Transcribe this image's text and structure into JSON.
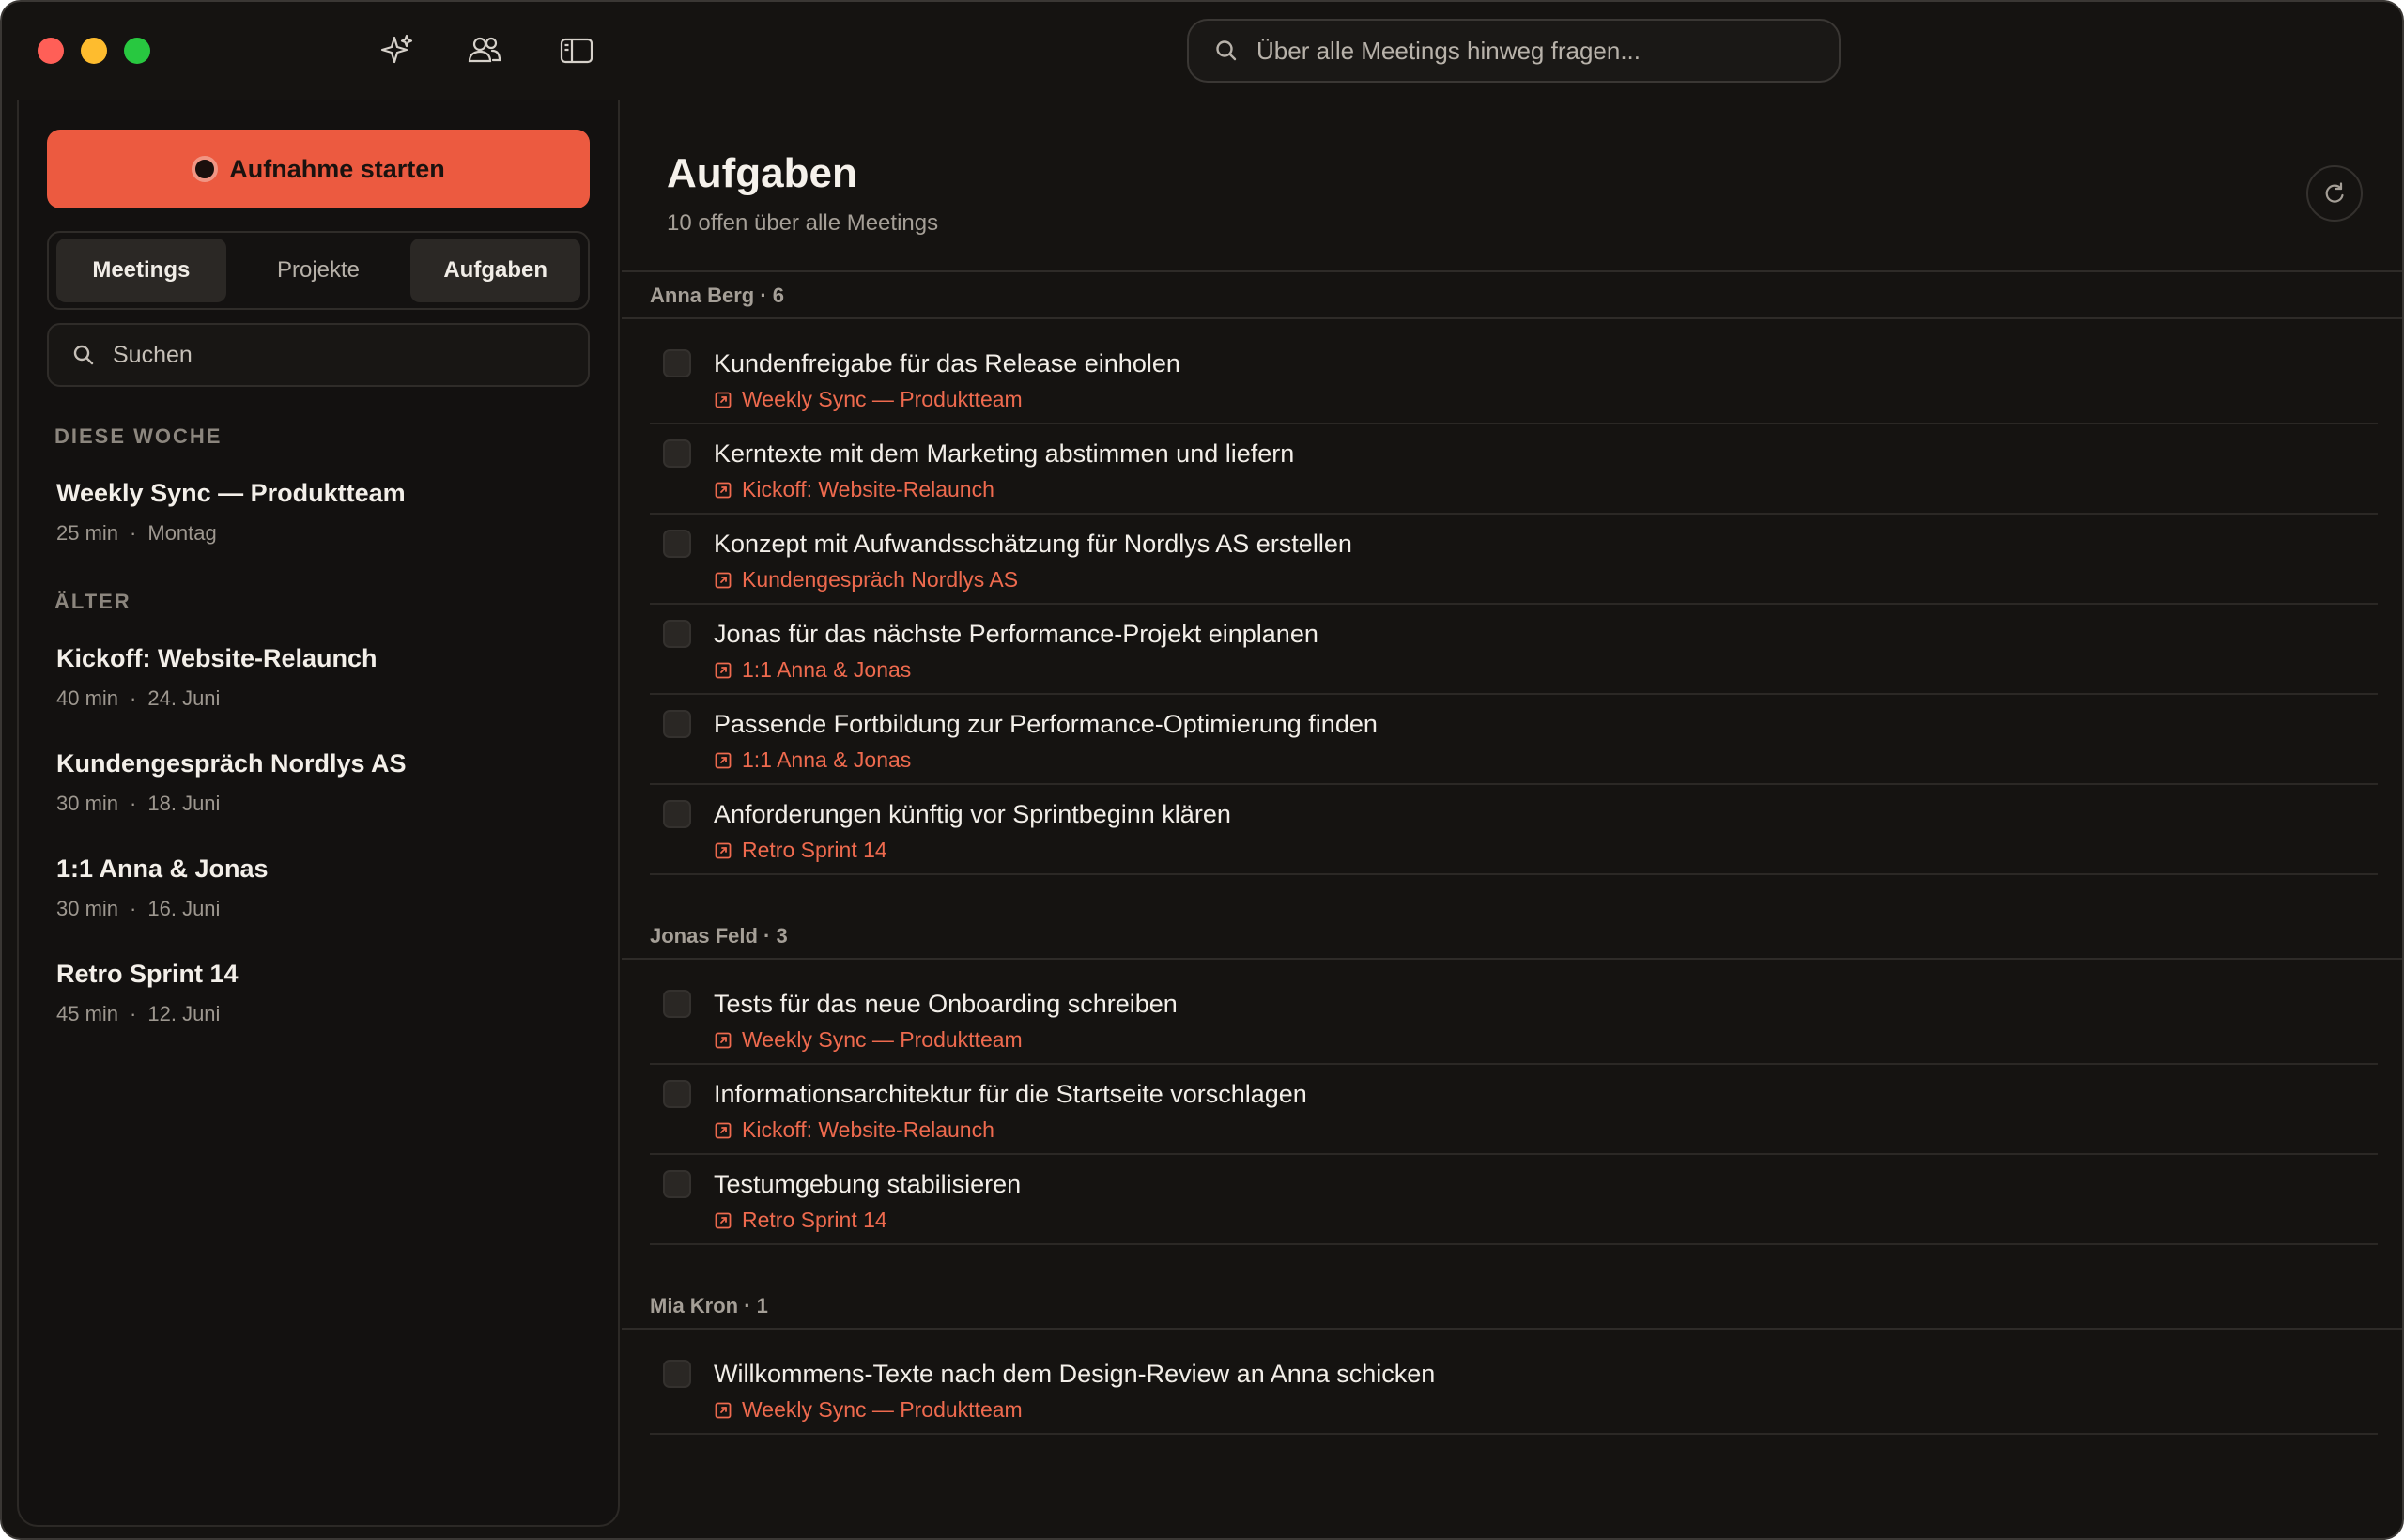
{
  "titlebar": {
    "icons": [
      "sparkles-icon",
      "people-icon",
      "sidebar-toggle-icon"
    ],
    "search_placeholder": "Über alle Meetings hinweg fragen..."
  },
  "sidebar": {
    "record_label": "Aufnahme starten",
    "tabs": [
      {
        "label": "Meetings",
        "active": true
      },
      {
        "label": "Projekte",
        "active": false
      },
      {
        "label": "Aufgaben",
        "active": true
      }
    ],
    "search_placeholder": "Suchen",
    "sections": [
      {
        "label": "DIESE WOCHE",
        "meetings": [
          {
            "title": "Weekly Sync — Produktteam",
            "duration": "25 min",
            "date": "Montag"
          }
        ]
      },
      {
        "label": "ÄLTER",
        "meetings": [
          {
            "title": "Kickoff: Website-Relaunch",
            "duration": "40 min",
            "date": "24. Juni"
          },
          {
            "title": "Kundengespräch Nordlys AS",
            "duration": "30 min",
            "date": "18. Juni"
          },
          {
            "title": "1:1 Anna & Jonas",
            "duration": "30 min",
            "date": "16. Juni"
          },
          {
            "title": "Retro Sprint 14",
            "duration": "45 min",
            "date": "12. Juni"
          }
        ]
      }
    ],
    "meta_separator": "·"
  },
  "main": {
    "title": "Aufgaben",
    "subtitle": "10 offen über alle Meetings",
    "groups": [
      {
        "header": "Anna Berg · 6",
        "tasks": [
          {
            "title": "Kundenfreigabe für das Release einholen",
            "meeting": "Weekly Sync — Produktteam",
            "done": false
          },
          {
            "title": "Kerntexte mit dem Marketing abstimmen und liefern",
            "meeting": "Kickoff: Website-Relaunch",
            "done": false
          },
          {
            "title": "Konzept mit Aufwandsschätzung für Nordlys AS erstellen",
            "meeting": "Kundengespräch Nordlys AS",
            "done": false
          },
          {
            "title": "Jonas für das nächste Performance-Projekt einplanen",
            "meeting": "1:1 Anna & Jonas",
            "done": false
          },
          {
            "title": "Passende Fortbildung zur Performance-Optimierung finden",
            "meeting": "1:1 Anna & Jonas",
            "done": false
          },
          {
            "title": "Anforderungen künftig vor Sprintbeginn klären",
            "meeting": "Retro Sprint 14",
            "done": false
          }
        ]
      },
      {
        "header": "Jonas Feld · 3",
        "tasks": [
          {
            "title": "Tests für das neue Onboarding schreiben",
            "meeting": "Weekly Sync — Produktteam",
            "done": false
          },
          {
            "title": "Informationsarchitektur für die Startseite vorschlagen",
            "meeting": "Kickoff: Website-Relaunch",
            "done": false
          },
          {
            "title": "Testumgebung stabilisieren",
            "meeting": "Retro Sprint 14",
            "done": false
          }
        ]
      },
      {
        "header": "Mia Kron · 1",
        "tasks": [
          {
            "title": "Willkommens-Texte nach dem Design-Review an Anna schicken",
            "meeting": "Weekly Sync — Produktteam",
            "done": false
          }
        ]
      }
    ]
  },
  "colors": {
    "background": "#151311",
    "accent": "#ec5a40",
    "link": "#ee6a4e",
    "text": "#f2eee8",
    "muted": "#a59f97"
  }
}
